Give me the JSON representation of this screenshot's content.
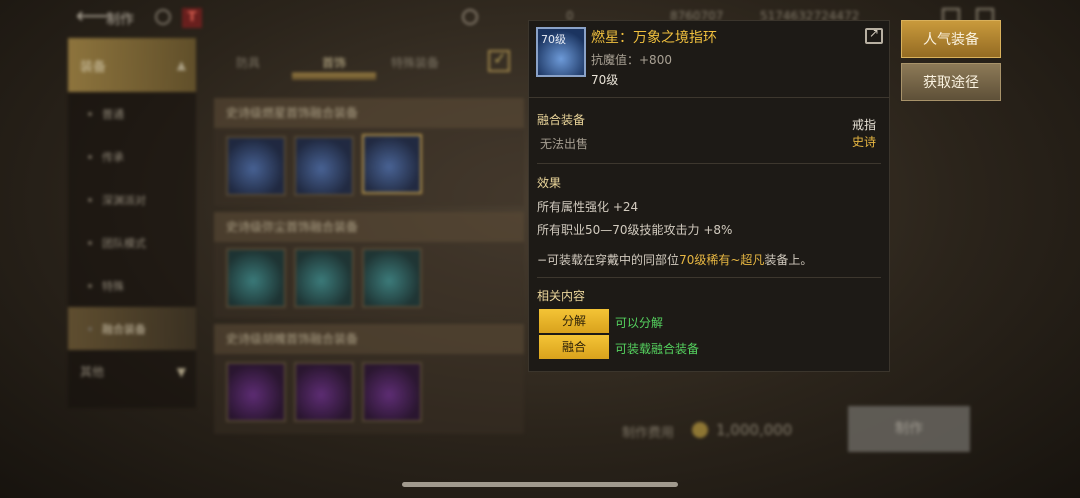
{
  "topbar": {
    "title": "制作",
    "badge": "T",
    "res1": "0",
    "res2": "8760707",
    "res3": "5174632724472"
  },
  "sidebar": {
    "category": "装备",
    "items": [
      "普通",
      "传承",
      "深渊派对",
      "团队模式",
      "特殊",
      "融合装备"
    ],
    "other": "其他"
  },
  "tabs": [
    "防具",
    "首饰",
    "特殊装备"
  ],
  "groups": [
    {
      "title": "史诗级燃星首饰融合装备"
    },
    {
      "title": "史诗级弥尘首饰融合装备"
    },
    {
      "title": "史诗级胡魄首饰融合装备"
    }
  ],
  "footer": {
    "cost_label": "制作费用",
    "cost_value": "1,000,000",
    "make_button": "制作"
  },
  "tooltip": {
    "level_badge": "70级",
    "name": "燃星：万象之境指环",
    "stat": "抗魔值：+800",
    "level": "70级",
    "section_fusion": "融合装备",
    "not_sellable": "无法出售",
    "slot": "戒指",
    "rarity": "史诗",
    "section_effect": "效果",
    "effect1": "所有属性强化 +24",
    "effect2": "所有职业50—70级技能攻击力 +8%",
    "note_prefix": "−可装载在穿戴中的同部位",
    "note_highlight": "70级稀有~超凡",
    "note_suffix": "装备上。",
    "section_related": "相关内容",
    "related": [
      {
        "button": "分解",
        "desc": "可以分解"
      },
      {
        "button": "融合",
        "desc": "可装载融合装备"
      }
    ]
  },
  "buttons": {
    "popular": "人气装备",
    "source": "获取途径"
  },
  "colors": {
    "item_name": "#efbf3e",
    "highlight": "#e6b642",
    "green_text": "#55d25f",
    "gold_button": "#f4c436"
  }
}
